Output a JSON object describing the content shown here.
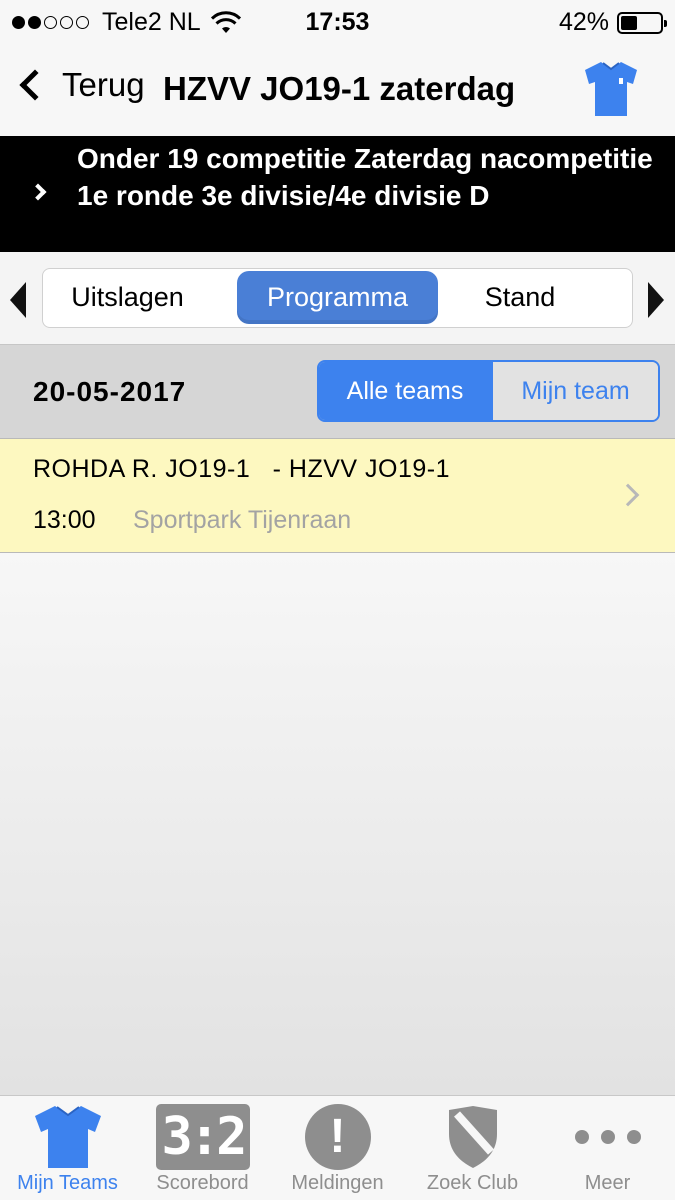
{
  "status_bar": {
    "carrier": "Tele2 NL",
    "time": "17:53",
    "battery": "42%",
    "battery_level": 0.42,
    "signal_bars": 2
  },
  "nav": {
    "back_label": "Terug",
    "title": "HZVV JO19-1 zaterdag",
    "shirt_color": "#3d82ee"
  },
  "competition": {
    "title": "Onder 19 competitie Zaterdag nacompetitie 1e ronde 3e divisie/4e divisie D"
  },
  "tabs": [
    {
      "label": "Uitslagen"
    },
    {
      "label": "Programma",
      "selected": true
    },
    {
      "label": "Stand"
    }
  ],
  "date_section": {
    "date": "20-05-2017",
    "filter_all": "Alle teams",
    "filter_mine": "Mijn team"
  },
  "matches": [
    {
      "teams": "ROHDA R. JO19-1   - HZVV JO19-1",
      "time": "13:00",
      "venue": "Sportpark Tijenraan"
    }
  ],
  "tab_bar": [
    {
      "label": "Mijn Teams",
      "icon": "shirt-icon",
      "active": true
    },
    {
      "label": "Scorebord",
      "icon": "scoreboard-icon",
      "glyph": "3:2"
    },
    {
      "label": "Meldingen",
      "icon": "alert-icon",
      "glyph": "!"
    },
    {
      "label": "Zoek Club",
      "icon": "shield-icon"
    },
    {
      "label": "Meer",
      "icon": "more-icon"
    }
  ],
  "colors": {
    "accent": "#3d82ee",
    "tab_selected": "#4a7fd6",
    "match_row_bg": "#fdf8c0",
    "icon_inactive": "#8e8e8e"
  }
}
